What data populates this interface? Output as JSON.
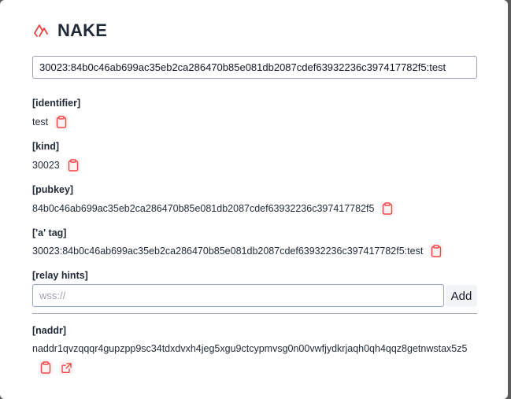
{
  "app": {
    "title": "NAKE",
    "brand_color": "#ef4444"
  },
  "search": {
    "value": "30023:84b0c46ab699ac35eb2ca286470b85e081db2087cdef63932236c397417782f5:test"
  },
  "fields": {
    "identifier": {
      "label": "[identifier]",
      "value": "test"
    },
    "kind": {
      "label": "[kind]",
      "value": "30023"
    },
    "pubkey": {
      "label": "[pubkey]",
      "value": "84b0c46ab699ac35eb2ca286470b85e081db2087cdef63932236c397417782f5"
    },
    "a_tag": {
      "label": "['a' tag]",
      "value": "30023:84b0c46ab699ac35eb2ca286470b85e081db2087cdef63932236c397417782f5:test"
    }
  },
  "relay_hints": {
    "label": "[relay hints]",
    "placeholder": "wss://",
    "value": "",
    "add_label": "Add"
  },
  "naddr": {
    "label": "[naddr]",
    "value": "naddr1qvzqqqr4gupzpp9sc34tdxdvxh4jeg5xgu9ctcypmvsg0n00vwfjydkrjaqh0qh4qqz8getnwstax5z5"
  },
  "icons": {
    "logo": "nake-logo-icon",
    "copy": "clipboard-icon",
    "open": "external-link-icon"
  }
}
